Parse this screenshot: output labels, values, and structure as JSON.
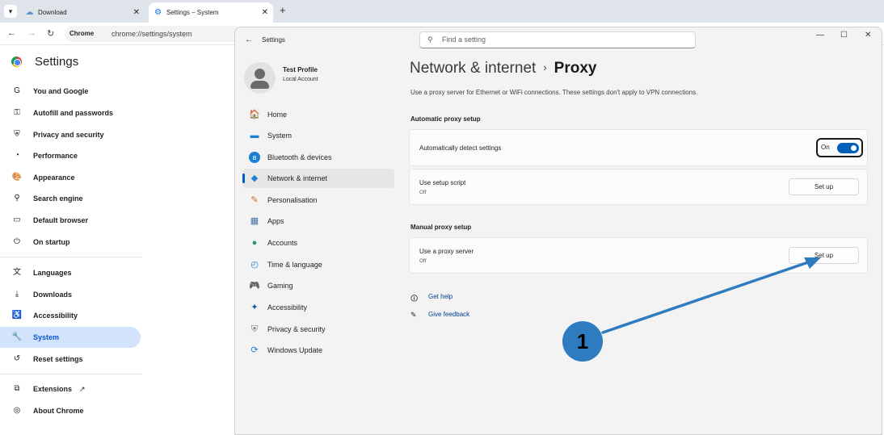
{
  "browser": {
    "tabs": [
      {
        "title": "Download",
        "icon": "cloud-icon",
        "close": "✕"
      },
      {
        "title": "Settings – System",
        "icon": "gear-icon",
        "close": "✕"
      }
    ],
    "new_tab": "+",
    "menu": "▾",
    "omnibox": {
      "chip": "Chrome",
      "url": "chrome://settings/system"
    }
  },
  "chrome_settings": {
    "title": "Settings",
    "nav": [
      {
        "label": "You and Google",
        "icon": "G"
      },
      {
        "label": "Autofill and passwords",
        "icon": "⚿"
      },
      {
        "label": "Privacy and security",
        "icon": "⛨"
      },
      {
        "label": "Performance",
        "icon": "◔"
      },
      {
        "label": "Appearance",
        "icon": "🎨"
      },
      {
        "label": "Search engine",
        "icon": "⚲"
      },
      {
        "label": "Default browser",
        "icon": "▭"
      },
      {
        "label": "On startup",
        "icon": "⏻"
      },
      {
        "label": "Languages",
        "icon": "文"
      },
      {
        "label": "Downloads",
        "icon": "⤓"
      },
      {
        "label": "Accessibility",
        "icon": "♿"
      },
      {
        "label": "System",
        "icon": "🔧"
      },
      {
        "label": "Reset settings",
        "icon": "↺"
      },
      {
        "label": "Extensions",
        "icon": "⧉"
      },
      {
        "label": "About Chrome",
        "icon": "◎"
      }
    ],
    "selected": "System"
  },
  "win_settings": {
    "title": "Settings",
    "search_placeholder": "Find a setting",
    "controls": {
      "minimize": "—",
      "maximize": "☐",
      "close": "✕"
    },
    "profile": {
      "name": "Test Profile",
      "account": "Local Account"
    },
    "nav": [
      {
        "label": "Home",
        "icon": "🏠",
        "color": "#e38a26"
      },
      {
        "label": "System",
        "icon": "▬",
        "color": "#1a7fd6"
      },
      {
        "label": "Bluetooth & devices",
        "icon": "ʙ",
        "color": "#1a7fd6"
      },
      {
        "label": "Network & internet",
        "icon": "◆",
        "color": "#1a7fd6"
      },
      {
        "label": "Personalisation",
        "icon": "✎",
        "color": "#d46a2e"
      },
      {
        "label": "Apps",
        "icon": "▦",
        "color": "#4a6fa5"
      },
      {
        "label": "Accounts",
        "icon": "●",
        "color": "#1f9e6b"
      },
      {
        "label": "Time & language",
        "icon": "◴",
        "color": "#1a7fd6"
      },
      {
        "label": "Gaming",
        "icon": "🎮",
        "color": "#6b6b6b"
      },
      {
        "label": "Accessibility",
        "icon": "✦",
        "color": "#1a55a6"
      },
      {
        "label": "Privacy & security",
        "icon": "⛨",
        "color": "#7a7a7a"
      },
      {
        "label": "Windows Update",
        "icon": "⟳",
        "color": "#1a7fd6"
      }
    ],
    "selected": "Network & internet",
    "breadcrumb": {
      "parent": "Network & internet",
      "separator": "›",
      "current": "Proxy"
    },
    "description": "Use a proxy server for Ethernet or WiFi connections. These settings don't apply to VPN connections.",
    "automatic": {
      "heading": "Automatic proxy setup",
      "detect": {
        "label": "Automatically detect settings",
        "state": "On"
      },
      "script": {
        "label": "Use setup script",
        "status": "Off",
        "button": "Set up"
      }
    },
    "manual": {
      "heading": "Manual proxy setup",
      "server": {
        "label": "Use a proxy server",
        "status": "Off",
        "button": "Set up"
      }
    },
    "links": {
      "help": "Get help",
      "feedback": "Give feedback"
    }
  },
  "annotation": {
    "number": "1",
    "color": "#2f7bc0"
  }
}
